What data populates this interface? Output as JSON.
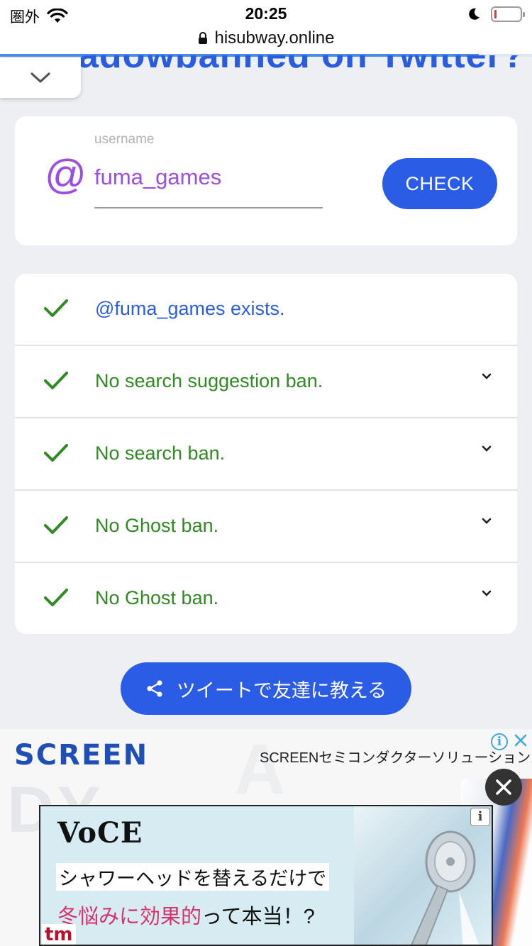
{
  "status_bar": {
    "carrier": "圏外",
    "time": "20:25"
  },
  "address_bar": {
    "url": "hisubway.online",
    "load_progress": 0.9
  },
  "heading_peek": "adowbanned on Twitter?",
  "form": {
    "label": "username",
    "at_symbol": "@",
    "value": "fuma_games",
    "check_label": "CHECK"
  },
  "results": [
    {
      "text": "@fuma_games exists.",
      "status": "ok",
      "expandable": false,
      "color": "#2a5ce6"
    },
    {
      "text": "No search suggestion ban.",
      "status": "ok",
      "expandable": true,
      "color": "#2f8a22"
    },
    {
      "text": "No search ban.",
      "status": "ok",
      "expandable": true,
      "color": "#2f8a22"
    },
    {
      "text": "No Ghost ban.",
      "status": "ok",
      "expandable": true,
      "color": "#2f8a22"
    },
    {
      "text": "No Ghost ban.",
      "status": "ok",
      "expandable": true,
      "color": "#2f8a22"
    }
  ],
  "share": {
    "label": "ツイートで友達に教える"
  },
  "ad": {
    "brand": "SCREEN",
    "subtitle": "SCREENセミコンダクターソリューションズ",
    "info": "i"
  },
  "overlay_ad": {
    "logo": "VoCE",
    "line1": "シャワーヘッドを替えるだけで",
    "line2_highlight": "冬悩みに効果的",
    "line2_rest": "って本当！?",
    "tm": "tm",
    "info": "i"
  },
  "colors": {
    "accent_blue": "#2a5ce6",
    "success_green": "#2f8a22",
    "username_purple": "#9c4ee0"
  }
}
